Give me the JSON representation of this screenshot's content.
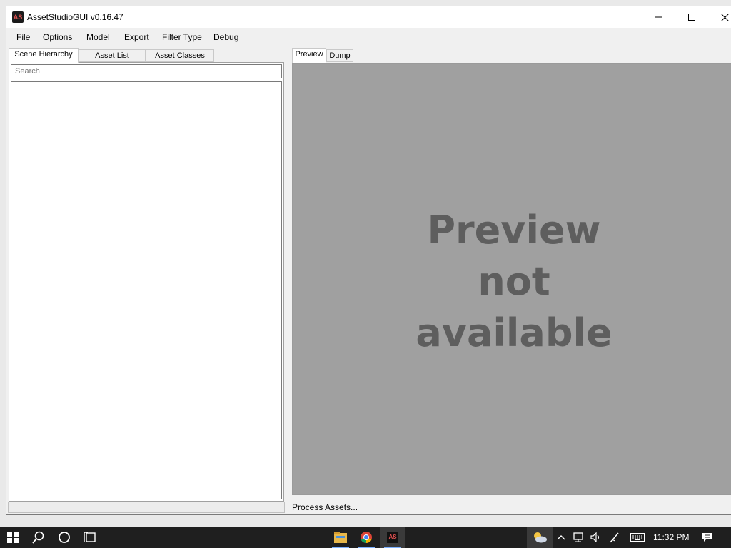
{
  "window": {
    "title": "AssetStudioGUI v0.16.47",
    "app_icon_text": "AS"
  },
  "menu": {
    "items": [
      "File",
      "Options",
      "Model",
      "Export",
      "Filter Type",
      "Debug"
    ]
  },
  "left_tabs": [
    "Scene Hierarchy",
    "Asset List",
    "Asset Classes"
  ],
  "search": {
    "placeholder": "Search",
    "value": ""
  },
  "right_tabs": [
    "Preview",
    "Dump"
  ],
  "preview": {
    "message": "Preview\nnot\navailable"
  },
  "status": {
    "text": "Process Assets..."
  },
  "taskbar": {
    "time": "11:32 PM",
    "pinned_icons": [
      "file-explorer-icon",
      "chrome-icon",
      "assetstudio-icon"
    ],
    "tray_icons": [
      "weather-icon",
      "chevron-up-icon",
      "network-icon",
      "volume-icon",
      "pen-icon",
      "keyboard-icon",
      "notification-icon"
    ]
  },
  "colors": {
    "preview_bg": "#a0a0a0",
    "preview_text": "#5e5e5e",
    "taskbar_bg": "#1f1f1f",
    "window_bg": "#f0f0f0"
  }
}
